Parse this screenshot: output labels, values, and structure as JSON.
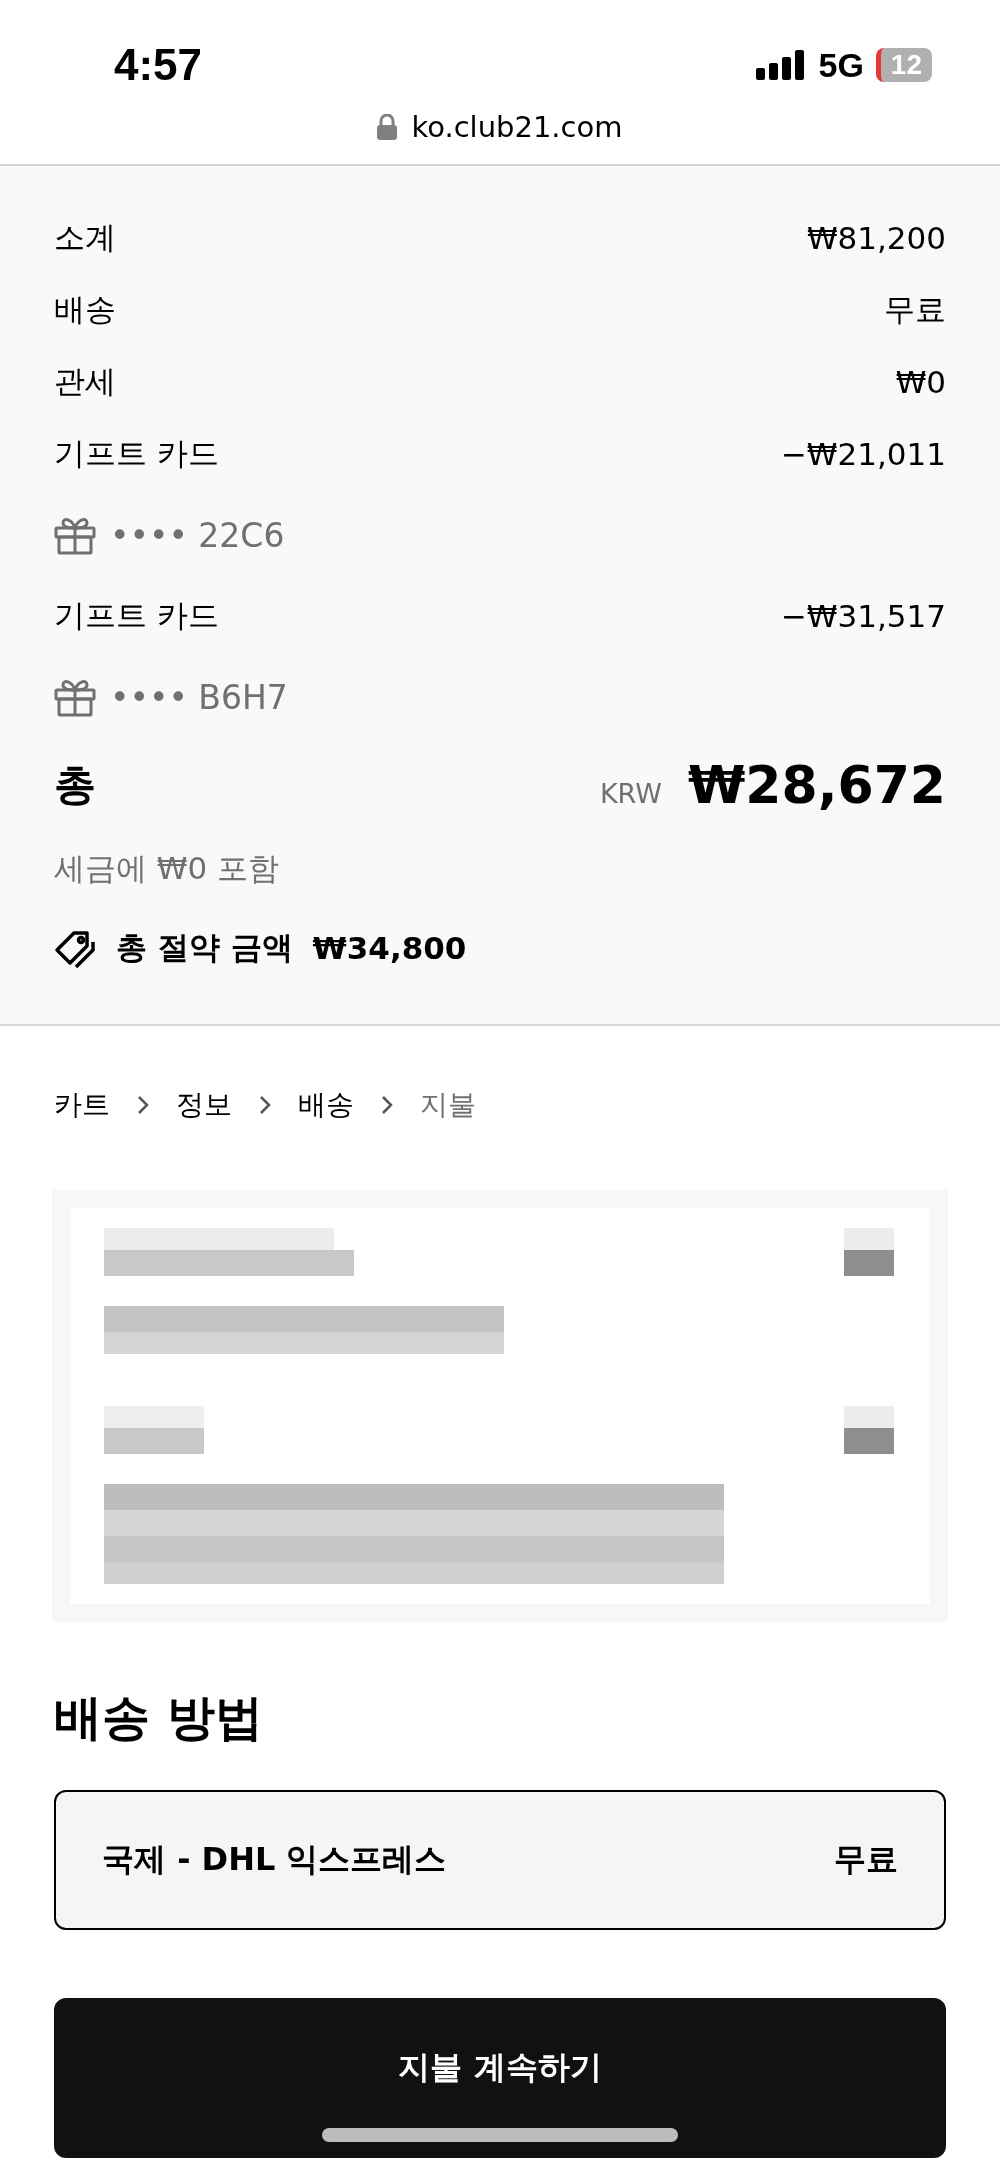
{
  "status_bar": {
    "time": "4:57",
    "network": "5G",
    "battery": "12"
  },
  "address_bar": {
    "url": "ko.club21.com"
  },
  "summary": {
    "lines": [
      {
        "kind": "line",
        "label": "소계",
        "value": "₩81,200"
      },
      {
        "kind": "line",
        "label": "배송",
        "value": "무료"
      },
      {
        "kind": "line",
        "label": "관세",
        "value": "₩0"
      },
      {
        "kind": "line",
        "label": "기프트 카드",
        "value": "−₩21,011"
      },
      {
        "kind": "gift_card",
        "code": "•••• 22C6"
      },
      {
        "kind": "line",
        "label": "기프트 카드",
        "value": "−₩31,517"
      },
      {
        "kind": "gift_card",
        "code": "•••• B6H7"
      }
    ],
    "total": {
      "label": "총",
      "currency": "KRW",
      "value": "₩28,672"
    },
    "tax_note": "세금에 ₩0 포함",
    "savings": {
      "label": "총 절약 금액",
      "value": "₩34,800"
    }
  },
  "breadcrumb": [
    {
      "label": "카트",
      "selected": false
    },
    {
      "label": "정보",
      "selected": false
    },
    {
      "label": "배송",
      "selected": false
    },
    {
      "label": "지불",
      "selected": true
    }
  ],
  "shipping": {
    "title": "배송 방법",
    "options": [
      {
        "label": "국제 - DHL 익스프레스",
        "price": "무료",
        "selected": true
      }
    ]
  },
  "continue_button": "지불 계속하기"
}
